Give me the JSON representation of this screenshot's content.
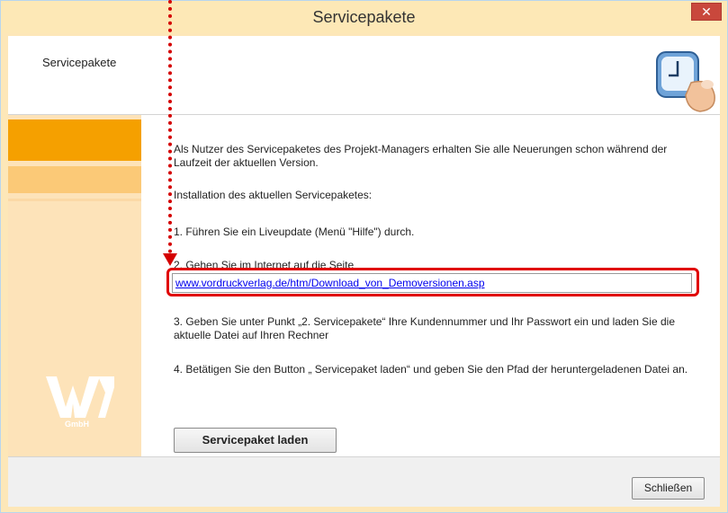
{
  "window": {
    "title": "Servicepakete",
    "close_symbol": "✕"
  },
  "header": {
    "label": "Servicepakete"
  },
  "sidebar": {
    "logo_sub": "GmbH"
  },
  "content": {
    "intro": "Als Nutzer des Servicepaketes des Projekt-Managers erhalten Sie alle Neuerungen schon während der Laufzeit der aktuellen Version.",
    "install_heading": "Installation des aktuellen Servicepaketes:",
    "step1": "1. Führen Sie ein Liveupdate (Menü \"Hilfe\") durch.",
    "step2": "2. Gehen Sie im Internet auf die Seite",
    "link": "www.vordruckverlag.de/htm/Download_von_Demoversionen.asp",
    "step3": "3. Geben Sie unter Punkt „2. Servicepakete“ Ihre Kundennummer und Ihr Passwort ein und laden Sie die aktuelle Datei auf Ihren Rechner",
    "step4": "4. Betätigen Sie den Button „ Servicepaket laden“ und geben Sie den Pfad der heruntergeladenen Datei an.",
    "load_button": "Servicepaket laden"
  },
  "footer": {
    "close_button": "Schließen"
  },
  "colors": {
    "accent_orange": "#f5a000",
    "annotation_red": "#e00000",
    "link": "#0000ee"
  }
}
